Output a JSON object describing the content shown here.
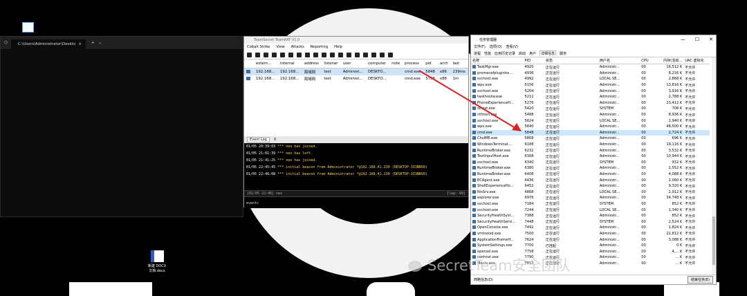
{
  "desktop": {
    "doc_icon_label": "新建 DOCX 文档.docx"
  },
  "terminal": {
    "tab_title": "C:\\Users\\Administrator\\Deskto",
    "new_tab": "+",
    "dropdown": "⌄",
    "prompt": "ernmn>"
  },
  "cobalt": {
    "title": "TeamSecret  TeamRAT V1.0",
    "menu": [
      "Cobalt Strike",
      "View",
      "Attacks",
      "Reporting",
      "Help"
    ],
    "columns": [
      "extern...",
      "internal",
      "address",
      "listener",
      "user",
      "computer",
      "note",
      "process",
      "pid",
      "arch",
      "last"
    ],
    "rows": [
      {
        "extern": "192.168...",
        "internal": "192.168...",
        "address": "局域网",
        "listener": "test",
        "user": "Administ...",
        "computer": "DESKTO...",
        "note": "",
        "process": "cmd.exe",
        "pid": "5848",
        "arch": "x86",
        "last": "239ms"
      },
      {
        "extern": "192.168...",
        "internal": "192.168...",
        "address": "局域网",
        "listener": "test",
        "user": "Administ...",
        "computer": "DESKTO...",
        "note": "",
        "process": "cmd.exe",
        "pid": "5756",
        "arch": "x86",
        "last": "1m"
      }
    ],
    "event_tab": "Event Log",
    "event_tab_close": "X",
    "events": [
      {
        "ts": "01/05 20:39:03",
        "marker": "***",
        "text": "neo has joined."
      },
      {
        "ts": "01/05 21:01:39",
        "marker": "***",
        "text": "neo has left."
      },
      {
        "ts": "01/05 21:41:25",
        "marker": "***",
        "text": "neo has joined."
      },
      {
        "ts": "01/05 22:45:45",
        "marker": "***",
        "text": "initial beacon from Administrator *@192.168.41.130 (DESKTOP-3I3NBV8)"
      },
      {
        "ts": "01/05 22:46:08",
        "marker": "***",
        "text": "initial beacon from Administrator *@192.168.41.130 (DESKTOP-3I3NBV8)"
      }
    ],
    "status_left": "[01/05 22:46] neo",
    "status_right": "[lag: 00]",
    "prompt": "event>"
  },
  "taskmgr": {
    "title": "任务管理器",
    "menu": [
      "文件(F)",
      "选项(O)",
      "查看(V)"
    ],
    "tabs": [
      "进程",
      "性能",
      "应用历史记录",
      "启动",
      "用户",
      "详细信息",
      "服务"
    ],
    "active_tab": "详细信息",
    "columns": [
      "名称",
      "PID",
      "状态",
      "用户名",
      "CPU",
      "内存(活动...",
      "UAC 虚拟化"
    ],
    "rows": [
      [
        "TaskMgr.exe",
        "4920",
        "正在运行",
        "Administr...",
        "00",
        "16,512 K",
        "不允许"
      ],
      [
        "promecefpluginho...",
        "4936",
        "正在运行",
        "Administr...",
        "00",
        "8,216 K",
        "不允许"
      ],
      [
        "svchost.exe",
        "4992",
        "正在运行",
        "LOCAL SE...",
        "00",
        "2,868 K",
        "不允许"
      ],
      [
        "wps.exe",
        "5156",
        "正在运行",
        "Administr...",
        "00",
        "13,816 K",
        "不允许"
      ],
      [
        "svchost.exe",
        "5204",
        "正在运行",
        "Administr...",
        "00",
        "3,916 K",
        "不允许"
      ],
      [
        "taskhostw.exe",
        "5212",
        "正在运行",
        "Administr...",
        "00",
        "2,788 K",
        "不允许"
      ],
      [
        "PhoneExperienceH...",
        "5276",
        "正在运行",
        "Administr...",
        "00",
        "23,412 K",
        "不允许"
      ],
      [
        "sihost.exe",
        "5420",
        "正在运行",
        "SYSTEM",
        "00",
        "708 K",
        "不允许"
      ],
      [
        "ctfmon.exe",
        "5488",
        "正在运行",
        "Administr...",
        "00",
        "8,936 K",
        "不允许"
      ],
      [
        "svchost.exe",
        "5624",
        "正在运行",
        "LOCAL SE...",
        "00",
        "2,940 K",
        "不允许"
      ],
      [
        "wps.exe",
        "5840",
        "正在运行",
        "Administr...",
        "00",
        "48,500 K",
        "不允许"
      ],
      [
        "cmd.exe",
        "5848",
        "正在运行",
        "Administr...",
        "00",
        "2,724 K",
        "不允许"
      ],
      [
        "ChsIME.exe",
        "5868",
        "正在运行",
        "Administr...",
        "00",
        "696 K",
        "不允许"
      ],
      [
        "WindowsTerminal....",
        "6188",
        "正在运行",
        "Administr...",
        "00",
        "19,116 K",
        "不允许"
      ],
      [
        "RuntimeBroker.exe",
        "6232",
        "正在运行",
        "Administr...",
        "00",
        "3,532 K",
        "不允许"
      ],
      [
        "TextInputHost.exe",
        "6308",
        "正在运行",
        "Administr...",
        "00",
        "10,944 K",
        "不允许"
      ],
      [
        "svchost.exe",
        "6340",
        "正在运行",
        "SYSTEM",
        "00",
        "932 K",
        "不允许"
      ],
      [
        "RuntimeBroker.exe",
        "6380",
        "正在运行",
        "Administr...",
        "00",
        "2,552 K",
        "不允许"
      ],
      [
        "RuntimeBroker.exe",
        "6408",
        "正在运行",
        "Administr...",
        "00",
        "4,088 K",
        "不允许"
      ],
      [
        "ECAgent.exe",
        "6436",
        "正在运行",
        "Administr...",
        "00",
        "2,060 K",
        "不允许"
      ],
      [
        "ShellExperienceHo...",
        "6452",
        "正在运行",
        "Administr...",
        "00",
        "9,320 K",
        "不允许"
      ],
      [
        "NisSrv.exe",
        "6868",
        "正在运行",
        "LOCAL SE...",
        "00",
        "2,912 K",
        "不允许"
      ],
      [
        "explorer.exe",
        "6976",
        "正在运行",
        "Administr...",
        "00",
        "34,748 K",
        "不允许"
      ],
      [
        "svchost.exe",
        "7184",
        "正在运行",
        "SYSTEM",
        "00",
        "852 K",
        "不允许"
      ],
      [
        "svchost.exe",
        "7244",
        "正在运行",
        "LOCAL SE...",
        "00",
        "1,340 K",
        "不允许"
      ],
      [
        "SecurityHealthSyst...",
        "7388",
        "正在运行",
        "Administr...",
        "00",
        "852 K",
        "不允许"
      ],
      [
        "SecurityHealthServi...",
        "7448",
        "正在运行",
        "SYSTEM",
        "00",
        "2,524 K",
        "不允许"
      ],
      [
        "OpenConsole.exe",
        "7492",
        "正在运行",
        "Administr...",
        "00",
        "1,824 K",
        "不允许"
      ],
      [
        "vmtoolsd.exe",
        "7500",
        "正在运行",
        "Administr...",
        "00",
        "22,812 K",
        "不允许"
      ],
      [
        "ApplicationFrameH...",
        "7624",
        "正在运行",
        "Administr...",
        "00",
        "3,088 K",
        "不允许"
      ],
      [
        "SystemSettings.exe",
        "7700",
        "已挂起",
        "Administr...",
        "00",
        "0 K",
        "不允许"
      ],
      [
        "openssl.exe",
        "7758",
        "正在运行",
        "Administr...",
        "00",
        "4,... K",
        "不允许"
      ],
      [
        "conhost.exe",
        "7790",
        "正在运行",
        "Administr...",
        "00",
        "... K",
        "不允许"
      ],
      [
        "Movie.exe",
        "7832",
        "正在运行",
        "Administr...",
        "00",
        "... K",
        "不允许"
      ]
    ],
    "selected_pid": "5848",
    "footer_left": "简略信息(D)",
    "footer_right": "结束任务(E)"
  },
  "watermark": "SecretTeam安全团队",
  "colors": {
    "arrow": "#e02020",
    "selection": "#cce8ff",
    "event_highlight": "#ffd84a"
  }
}
